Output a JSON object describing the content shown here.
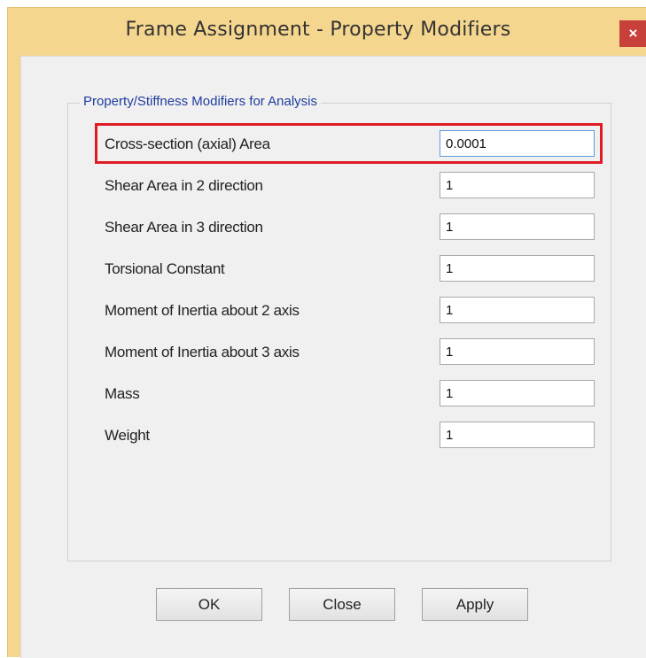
{
  "window": {
    "title": "Frame Assignment - Property Modifiers",
    "close_glyph": "×"
  },
  "group": {
    "legend": "Property/Stiffness Modifiers for Analysis"
  },
  "modifiers": [
    {
      "label": "Cross-section (axial) Area",
      "value": "0.0001"
    },
    {
      "label": "Shear Area in 2 direction",
      "value": "1"
    },
    {
      "label": "Shear Area in 3 direction",
      "value": "1"
    },
    {
      "label": "Torsional Constant",
      "value": "1"
    },
    {
      "label": "Moment of Inertia about 2 axis",
      "value": "1"
    },
    {
      "label": "Moment of Inertia about 3 axis",
      "value": "1"
    },
    {
      "label": "Mass",
      "value": "1"
    },
    {
      "label": "Weight",
      "value": "1"
    }
  ],
  "buttons": {
    "ok": "OK",
    "close": "Close",
    "apply": "Apply"
  },
  "colors": {
    "title_bar": "#f5d68f",
    "close_button": "#c7403a",
    "highlight": "#e01b24",
    "legend_text": "#1f3c9e"
  }
}
